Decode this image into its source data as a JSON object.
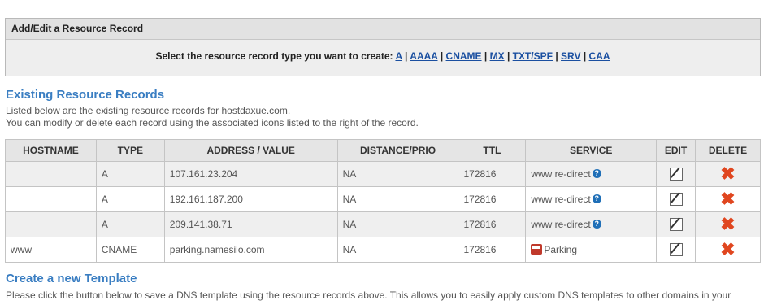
{
  "panel": {
    "title": "Add/Edit a Resource Record",
    "prompt": "Select the resource record type you want to create:",
    "types": [
      "A",
      "AAAA",
      "CNAME",
      "MX",
      "TXT/SPF",
      "SRV",
      "CAA"
    ]
  },
  "existing": {
    "title": "Existing Resource Records",
    "line1": "Listed below are the existing resource records for hostdaxue.com.",
    "line2": "You can modify or delete each record using the associated icons listed to the right of the record."
  },
  "table": {
    "headers": [
      "HOSTNAME",
      "TYPE",
      "ADDRESS / VALUE",
      "DISTANCE/PRIO",
      "TTL",
      "SERVICE",
      "EDIT",
      "DELETE"
    ],
    "rows": [
      {
        "hostname": "",
        "type": "A",
        "address": "107.161.23.204",
        "distance": "NA",
        "ttl": "172816",
        "service": "www re-direct",
        "service_icon": "help-icon"
      },
      {
        "hostname": "",
        "type": "A",
        "address": "192.161.187.200",
        "distance": "NA",
        "ttl": "172816",
        "service": "www re-direct",
        "service_icon": "help-icon"
      },
      {
        "hostname": "",
        "type": "A",
        "address": "209.141.38.71",
        "distance": "NA",
        "ttl": "172816",
        "service": "www re-direct",
        "service_icon": "help-icon"
      },
      {
        "hostname": "www",
        "type": "CNAME",
        "address": "parking.namesilo.com",
        "distance": "NA",
        "ttl": "172816",
        "service": "Parking",
        "service_icon": "parking-icon"
      }
    ]
  },
  "template": {
    "title": "Create a new Template",
    "line1": "Please click the button below to save a DNS template using the resource records above. This allows you to easily apply custom DNS templates to other domains in your"
  },
  "colors": {
    "section_title": "#3a7ec2",
    "link": "#1a4fa0",
    "delete": "#e0461f"
  }
}
